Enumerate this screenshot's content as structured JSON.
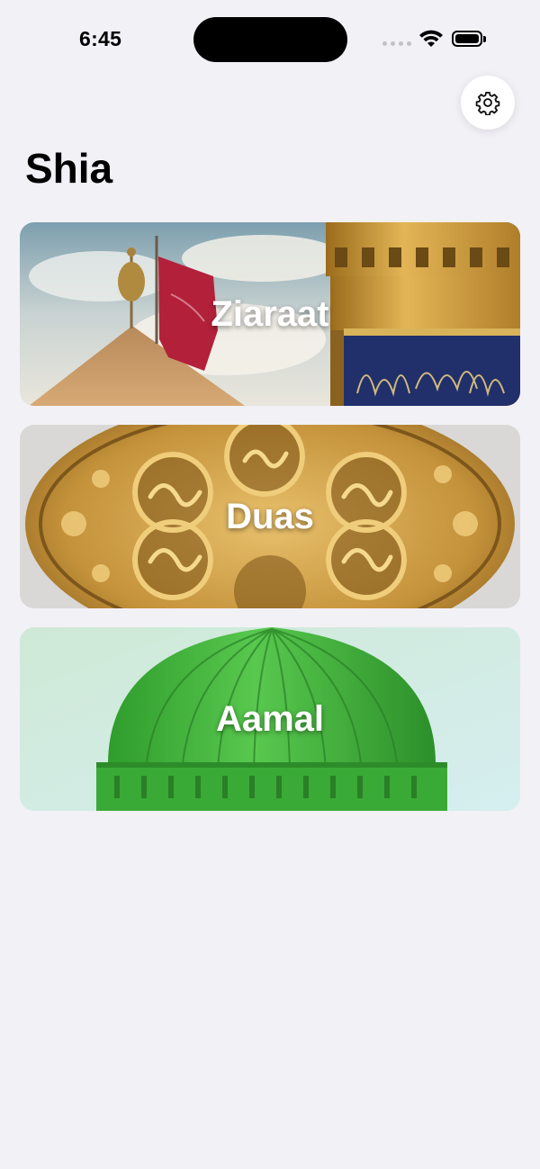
{
  "status_bar": {
    "time": "6:45"
  },
  "header": {
    "title": "Shia",
    "settings_icon": "gear-icon"
  },
  "cards": [
    {
      "label": "Ziaraat"
    },
    {
      "label": "Duas"
    },
    {
      "label": "Aamal"
    }
  ],
  "colors": {
    "background": "#f2f1f6",
    "dome_green": "#3fb83a",
    "flag_red": "#b3203a",
    "gold": "#c99a3c"
  }
}
